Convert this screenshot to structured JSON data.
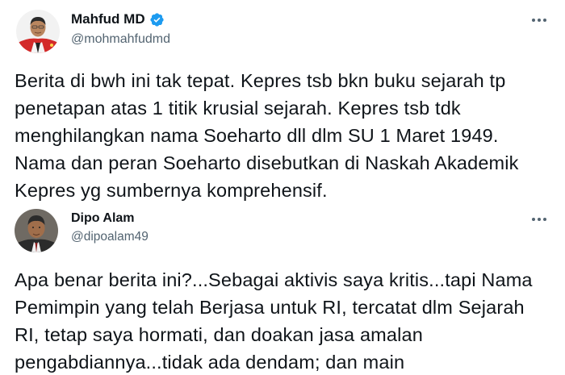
{
  "tweets": [
    {
      "author": {
        "name": "Mahfud MD",
        "handle": "@mohmahfudmd",
        "verified": true
      },
      "text": "Berita di bwh ini tak tepat. Kepres tsb bkn buku sejarah tp penetapan atas 1 titik krusial sejarah. Kepres tsb tdk menghilangkan nama Soeharto dll dlm SU 1 Maret 1949. Nama dan peran Soeharto disebutkan di Naskah Akademik Kepres yg sumbernya komprehensif."
    },
    {
      "author": {
        "name": "Dipo Alam",
        "handle": "@dipoalam49",
        "verified": false
      },
      "text": "Apa benar berita ini?...Sebagai aktivis saya kritis...tapi Nama Pemimpin yang telah Berjasa untuk RI, tercatat dlm Sejarah RI, tetap saya hormati, dan doakan jasa amalan pengabdiannya...tidak ada dendam; dan main"
    }
  ],
  "colors": {
    "verified_badge": "#1d9bf0",
    "secondary_text": "#536471",
    "primary_text": "#0f1419"
  },
  "icons": {
    "verified": "verified-badge-icon",
    "more": "more-options-icon"
  }
}
